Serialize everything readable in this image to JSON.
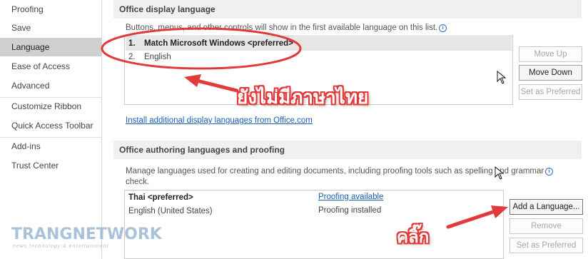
{
  "sidebar": {
    "items": [
      {
        "label": "Proofing",
        "selected": false
      },
      {
        "label": "Save",
        "selected": false
      },
      {
        "label": "Language",
        "selected": true
      },
      {
        "label": "Ease of Access",
        "selected": false
      },
      {
        "label": "Advanced",
        "selected": false
      },
      {
        "label": "Customize Ribbon",
        "selected": false
      },
      {
        "label": "Quick Access Toolbar",
        "selected": false
      },
      {
        "label": "Add-ins",
        "selected": false
      },
      {
        "label": "Trust Center",
        "selected": false
      }
    ]
  },
  "display_language": {
    "header": "Office display language",
    "description": "Buttons, menus, and other controls will show in the first available language on this list.",
    "list": [
      {
        "number": "1.",
        "label": "Match Microsoft Windows <preferred>"
      },
      {
        "number": "2.",
        "label": "English"
      }
    ],
    "buttons": {
      "move_up": "Move Up",
      "move_down": "Move Down",
      "set_preferred": "Set as Preferred"
    },
    "install_link": "Install additional display languages from Office.com"
  },
  "authoring": {
    "header": "Office authoring languages and proofing",
    "description_line1": "Manage languages used for creating and editing documents, including proofing tools such as spelling and grammar",
    "description_line2": "check.",
    "rows": [
      {
        "language": "Thai <preferred>",
        "status": "Proofing available",
        "status_is_link": true
      },
      {
        "language": "English (United States)",
        "status": "Proofing installed",
        "status_is_link": false
      }
    ],
    "buttons": {
      "add_language": "Add a Language...",
      "remove": "Remove",
      "set_preferred": "Set as Preferred"
    }
  },
  "annotations": {
    "no_thai_yet": "ยังไม่มีภาษาไทย",
    "click": "คลิ๊ก",
    "color": "#e23a3a"
  },
  "watermark": {
    "brand": "TRANGNETWORK",
    "tagline": "news technology & entertainment"
  }
}
